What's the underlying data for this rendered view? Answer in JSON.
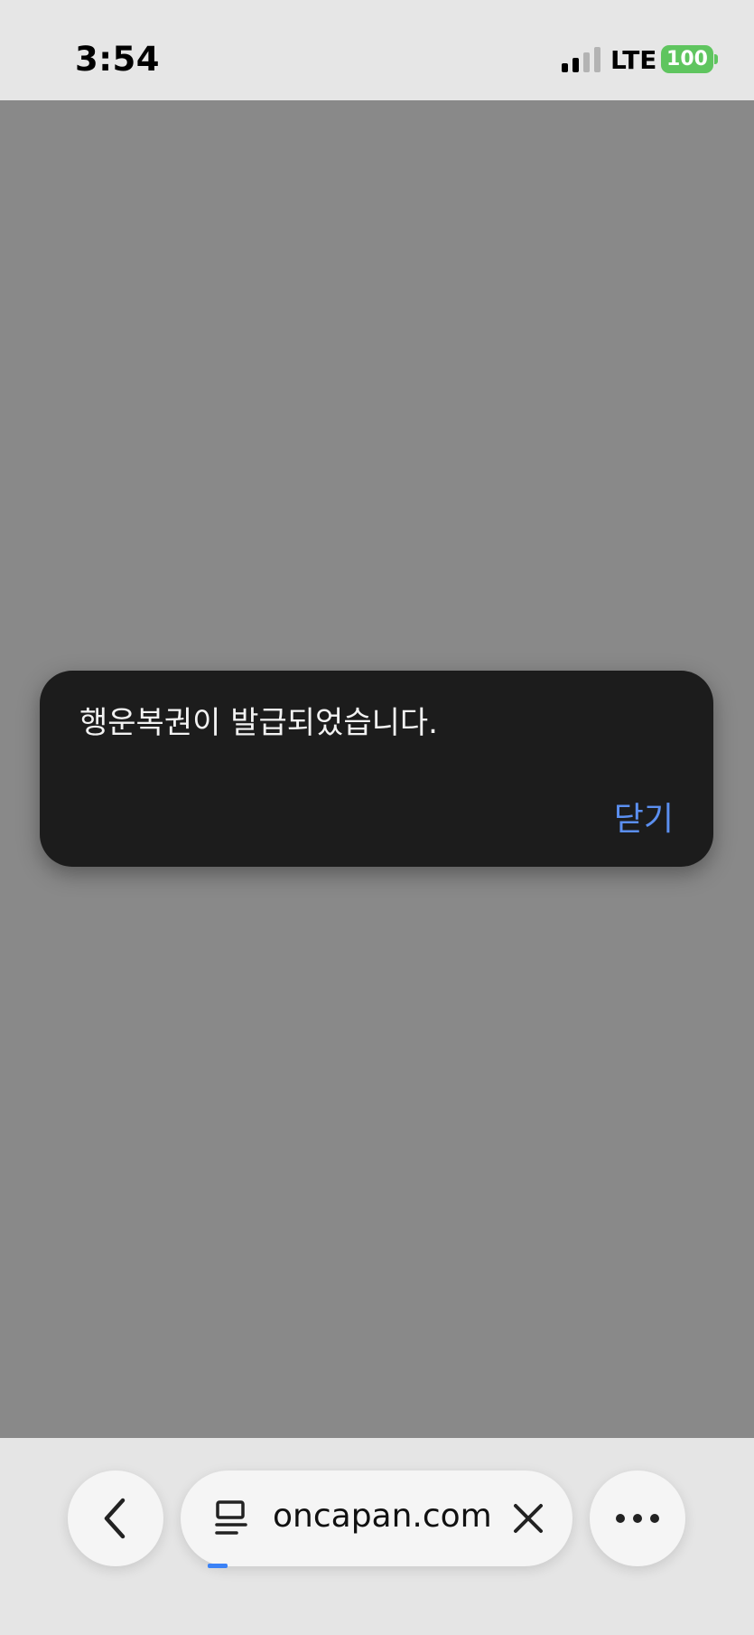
{
  "status_bar": {
    "time": "3:54",
    "network": "LTE",
    "battery": "100",
    "battery_color": "#5fc55f"
  },
  "dialog": {
    "message": "행운복권이 발급되었습니다.",
    "close_label": "닫기",
    "accent_color": "#5b8ff0"
  },
  "toolbar": {
    "url": "oncapan.com",
    "icons": {
      "back": "chevron-left-icon",
      "page": "page-info-icon",
      "clear": "close-icon",
      "more": "more-horizontal-icon"
    }
  }
}
